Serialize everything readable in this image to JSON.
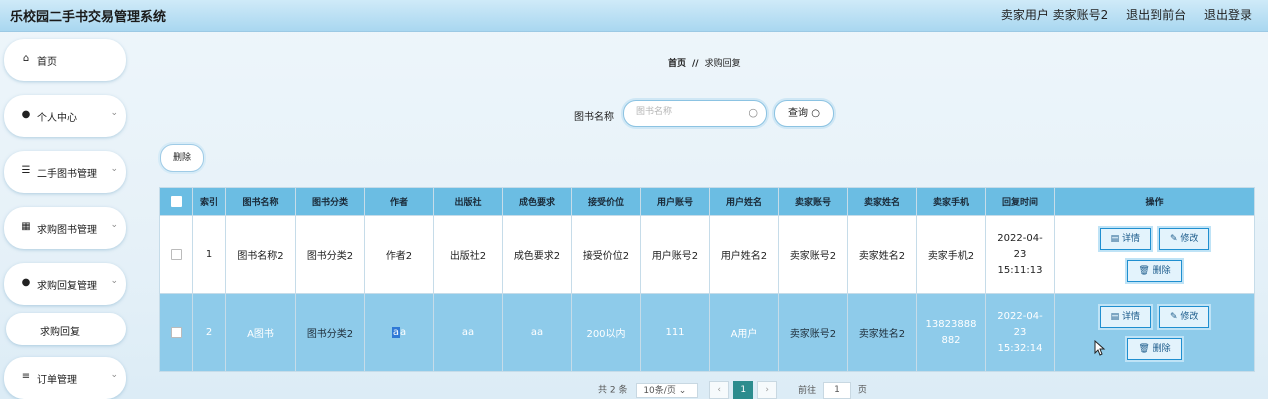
{
  "header": {
    "app_title": "乐校园二手书交易管理系统",
    "user_text": "卖家用户 卖家账号2",
    "front_link": "退出到前台",
    "logout_link": "退出登录"
  },
  "sidebar": {
    "items": [
      {
        "label": "首页",
        "icon": "home-icon"
      },
      {
        "label": "个人中心",
        "icon": "user-icon"
      },
      {
        "label": "二手图书管理",
        "icon": "sliders-icon"
      },
      {
        "label": "求购图书管理",
        "icon": "grid-icon"
      },
      {
        "label": "求购回复管理",
        "icon": "pin-icon"
      },
      {
        "label": "求购回复",
        "icon": ""
      },
      {
        "label": "订单管理",
        "icon": "list-icon"
      }
    ]
  },
  "breadcrumb": {
    "home": "首页",
    "sep": "//",
    "current": "求购回复"
  },
  "search": {
    "label": "图书名称",
    "placeholder": "图书名称",
    "button": "查询"
  },
  "toolbar": {
    "delete_label": "删除"
  },
  "table": {
    "headers": [
      "索引",
      "图书名称",
      "图书分类",
      "作者",
      "出版社",
      "成色要求",
      "接受价位",
      "用户账号",
      "用户姓名",
      "卖家账号",
      "卖家姓名",
      "卖家手机",
      "回复时间",
      "操作"
    ],
    "rows": [
      {
        "index": "1",
        "book": "图书名称2",
        "category": "图书分类2",
        "author": "作者2",
        "publisher": "出版社2",
        "condition": "成色要求2",
        "price": "接受价位2",
        "account": "用户账号2",
        "username": "用户姓名2",
        "seller_account": "卖家账号2",
        "seller_name": "卖家姓名2",
        "seller_phone": "卖家手机2",
        "time": "2022-04-23 15:11:13"
      },
      {
        "index": "2",
        "book": "A图书",
        "category": "图书分类2",
        "author_hl": "a",
        "author_rest": "a",
        "publisher": "aa",
        "condition": "aa",
        "price": "200以内",
        "account": "111",
        "username": "A用户",
        "seller_account": "卖家账号2",
        "seller_name": "卖家姓名2",
        "seller_phone": "13823888882",
        "time": "2022-04-23 15:32:14"
      }
    ],
    "actions": {
      "detail": "详情",
      "edit": "修改",
      "delete": "删除"
    }
  },
  "pagination": {
    "total": "共 2 条",
    "page_size": "10条/页",
    "current_page": "1",
    "goto_label": "前往",
    "goto_value": "1",
    "page_suffix": "页"
  }
}
